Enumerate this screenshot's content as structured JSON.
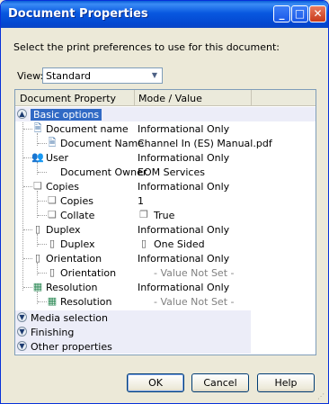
{
  "window": {
    "title": "Document Properties",
    "controls": {
      "minimize": "_",
      "maximize": "□",
      "close": "✕"
    }
  },
  "instruction": "Select the print preferences to use for this document:",
  "view": {
    "label": "View:",
    "value": "Standard"
  },
  "grid": {
    "headers": {
      "property": "Document Property",
      "value": "Mode / Value"
    },
    "rows": [
      {
        "name": "Basic options",
        "value": "",
        "icon": "collapse-icon"
      },
      {
        "name": "Document name",
        "value": "Informational Only",
        "icon": "document-icon"
      },
      {
        "name": "Document Name",
        "value": "Channel In (ES) Manual.pdf",
        "icon": "document-icon"
      },
      {
        "name": "User",
        "value": "Informational Only",
        "icon": "user-icon"
      },
      {
        "name": "Document Owner",
        "value": "EOM Services",
        "icon": ""
      },
      {
        "name": "Copies",
        "value": "Informational Only",
        "icon": "copies-icon"
      },
      {
        "name": "Copies",
        "value": "1",
        "icon": "copies-icon"
      },
      {
        "name": "Collate",
        "value": "True",
        "icon": "copies-icon",
        "value_icon": "collate-icon"
      },
      {
        "name": "Duplex",
        "value": "Informational Only",
        "icon": "duplex-icon"
      },
      {
        "name": "Duplex",
        "value": "One Sided",
        "icon": "duplex-icon",
        "value_icon": "one-sided-icon"
      },
      {
        "name": "Orientation",
        "value": "Informational Only",
        "icon": "orientation-icon"
      },
      {
        "name": "Orientation",
        "value": "- Value Not Set -",
        "icon": "orientation-icon"
      },
      {
        "name": "Resolution",
        "value": "Informational Only",
        "icon": "resolution-icon"
      },
      {
        "name": "Resolution",
        "value": "- Value Not Set -",
        "icon": "resolution-icon"
      },
      {
        "name": "Media selection",
        "value": "",
        "icon": "expand-icon"
      },
      {
        "name": "Finishing",
        "value": "",
        "icon": "expand-icon"
      },
      {
        "name": "Other properties",
        "value": "",
        "icon": "expand-icon"
      }
    ]
  },
  "buttons": {
    "ok": "OK",
    "cancel": "Cancel",
    "help": "Help"
  }
}
